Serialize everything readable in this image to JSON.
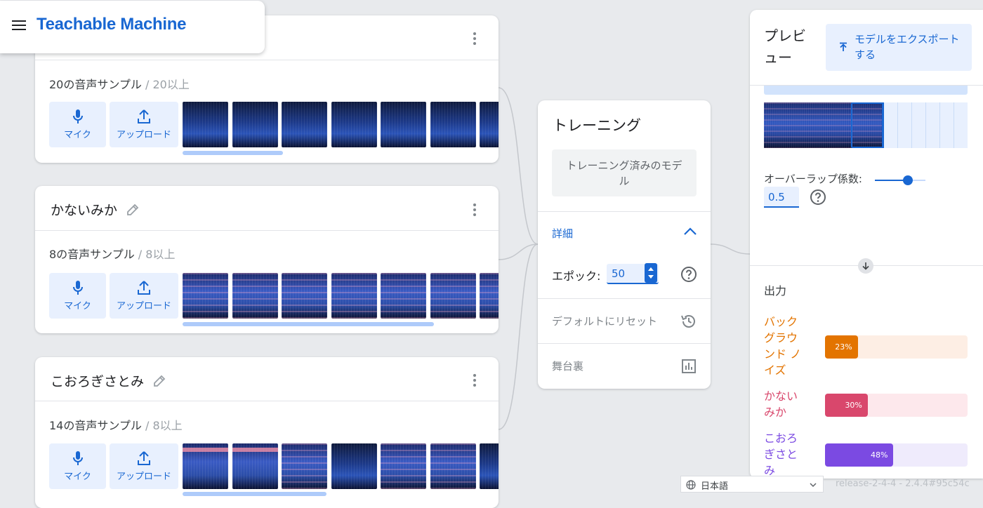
{
  "app": {
    "title": "Teachable Machine"
  },
  "classes": [
    {
      "name": "",
      "samples_text": "20の音声サンプル",
      "min_text": "/ 20以上",
      "mic_label": "マイク",
      "upload_label": "アップロード"
    },
    {
      "name": "かないみか",
      "samples_text": "8の音声サンプル",
      "min_text": "/ 8以上",
      "mic_label": "マイク",
      "upload_label": "アップロード"
    },
    {
      "name": "こおろぎさとみ",
      "samples_text": "14の音声サンプル",
      "min_text": "/ 8以上",
      "mic_label": "マイク",
      "upload_label": "アップロード"
    }
  ],
  "training": {
    "title": "トレーニング",
    "trained_button": "トレーニング済みのモデル",
    "advanced_label": "詳細",
    "epoch_label": "エポック:",
    "epoch_value": "50",
    "reset_label": "デフォルトにリセット",
    "under_hood_label": "舞台裏"
  },
  "preview": {
    "title": "プレビュー",
    "export_label": "モデルをエクスポートする",
    "overlap_label": "オーバーラップ係数:",
    "overlap_value": "0.5",
    "overlap_slider": 0.65,
    "output_title": "出力",
    "outputs": [
      {
        "label": "バックグラウンド ノイズ",
        "percent": 23,
        "percent_text": "23%",
        "color": "#e37400",
        "track": "#fdeee4",
        "text_color": "#e37400"
      },
      {
        "label": "かないみか",
        "percent": 30,
        "percent_text": "30%",
        "color": "#d9476c",
        "track": "#fde8ec",
        "text_color": "#d9476c"
      },
      {
        "label": "こおろぎさとみ",
        "percent": 48,
        "percent_text": "48%",
        "color": "#7b4ae2",
        "track": "#efebfc",
        "text_color": "#7b4ae2"
      }
    ]
  },
  "footer": {
    "language": "日本語",
    "version": "release-2-4-4 - 2.4.4#95c54c"
  },
  "colors": {
    "accent": "#1967d2",
    "accent_light": "#e8f0fe",
    "background": "#e8eaed"
  }
}
